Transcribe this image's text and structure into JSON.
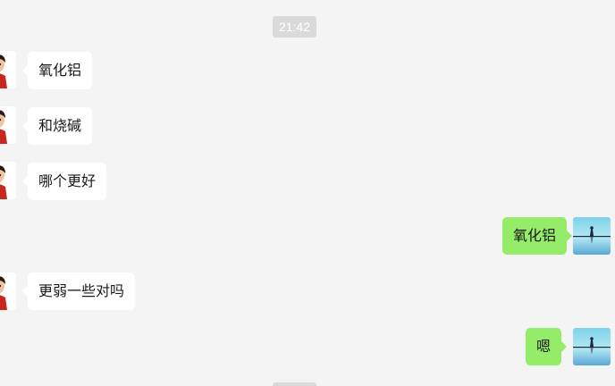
{
  "chat": {
    "timestamp": "21:42",
    "messages": [
      {
        "side": "left",
        "text": "氧化铝",
        "avatar": "cartoon-boy-avatar"
      },
      {
        "side": "left",
        "text": "和烧碱",
        "avatar": "cartoon-boy-avatar"
      },
      {
        "side": "left",
        "text": "哪个更好",
        "avatar": "cartoon-boy-avatar"
      },
      {
        "side": "right",
        "text": "氧化铝",
        "avatar": "lake-silhouette-avatar"
      },
      {
        "side": "left",
        "text": "更弱一些对吗",
        "avatar": "cartoon-boy-avatar"
      },
      {
        "side": "right",
        "text": "嗯",
        "avatar": "lake-silhouette-avatar"
      }
    ]
  },
  "colors": {
    "background": "#f4f4f4",
    "incoming_bubble": "#ffffff",
    "outgoing_bubble": "#95ec69",
    "timestamp_badge": "#dadada"
  }
}
